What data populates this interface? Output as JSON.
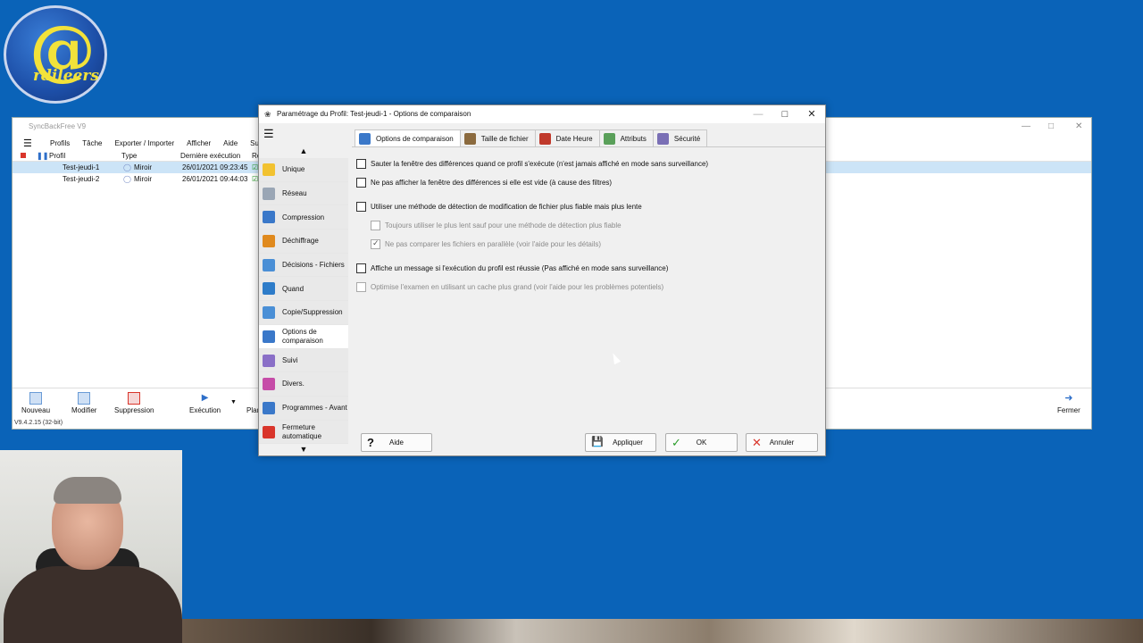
{
  "colors": {
    "desktop": "#0a63b8",
    "selection": "#cce4f7",
    "ok_green": "#2a9d2a",
    "cancel_red": "#d9352b"
  },
  "logo": {
    "text": "rdileers"
  },
  "syncback": {
    "title": "SyncBackFree V9",
    "menu": [
      "Profils",
      "Tâche",
      "Exporter / Importer",
      "Afficher",
      "Aide",
      "Sup"
    ],
    "columns": {
      "profile": "Profil",
      "type": "Type",
      "last_run": "Dernière exécution",
      "r": "Ré"
    },
    "rows": [
      {
        "name": "Test-jeudi-1",
        "type": "Miroir",
        "date": "26/01/2021 09:23:45"
      },
      {
        "name": "Test-jeudi-2",
        "type": "Miroir",
        "date": "26/01/2021 09:44:03"
      }
    ],
    "toolbar": {
      "new": "Nouveau",
      "edit": "Modifier",
      "delete": "Suppression",
      "run": "Exécution",
      "plan": "Plan",
      "close": "Fermer"
    },
    "status": "V9.4.2.15 (32-bit)"
  },
  "dialog": {
    "title": "Paramétrage du Profil: Test-jeudi-1 - Options de comparaison",
    "sidebar": [
      {
        "label": "Unique",
        "icon": "folder-icon",
        "color": "#f2c230"
      },
      {
        "label": "Réseau",
        "icon": "network-icon",
        "color": "#9aa6b5"
      },
      {
        "label": "Compression",
        "icon": "compression-icon",
        "color": "#3a78c9"
      },
      {
        "label": "Déchiffrage",
        "icon": "lock-icon",
        "color": "#e08a1e"
      },
      {
        "label": "Décisions - Fichiers",
        "icon": "decision-icon",
        "color": "#4a8fd6"
      },
      {
        "label": "Quand",
        "icon": "clock-icon",
        "color": "#2e7cc9"
      },
      {
        "label": "Copie/Suppression",
        "icon": "copy-icon",
        "color": "#4a8fd6"
      },
      {
        "label": "Options de comparaison",
        "icon": "compare-icon",
        "color": "#3a78c9"
      },
      {
        "label": "Suivi",
        "icon": "tracking-icon",
        "color": "#8a6fc7"
      },
      {
        "label": "Divers.",
        "icon": "misc-icon",
        "color": "#c64ca8"
      },
      {
        "label": "Programmes - Avant",
        "icon": "programs-icon",
        "color": "#3a78c9"
      },
      {
        "label": "Fermeture automatique",
        "icon": "close-red-icon",
        "color": "#d9352b"
      }
    ],
    "tabs": [
      {
        "label": "Options de comparaison",
        "icon": "compare-icon",
        "color": "#3a78c9"
      },
      {
        "label": "Taille de fichier",
        "icon": "scale-icon",
        "color": "#8b6a3e"
      },
      {
        "label": "Date Heure",
        "icon": "clock-icon",
        "color": "#c0392b"
      },
      {
        "label": "Attributs",
        "icon": "attributes-icon",
        "color": "#5aa05a"
      },
      {
        "label": "Sécurité",
        "icon": "security-icon",
        "color": "#7a6fb5"
      }
    ],
    "options": [
      "Sauter la fenêtre des différences quand ce profil s'exécute (n'est jamais affiché en mode sans surveillance)",
      "Ne pas afficher la fenêtre des différences si elle est vide (à cause des filtres)",
      "Utiliser une méthode de détection de modification de fichier plus fiable mais plus lente",
      "Toujours utiliser le plus lent sauf pour une méthode de détection plus fiable",
      "Ne pas comparer les fichiers en parallèle (voir l'aide pour les détails)",
      "Affiche un message si l'exécution du profil est réussie (Pas affiché en mode sans surveillance)",
      "Optimise l'examen en utilisant un cache plus grand (voir l'aide pour les problèmes potentiels)"
    ],
    "buttons": {
      "help": "Aide",
      "apply": "Appliquer",
      "ok": "OK",
      "cancel": "Annuler"
    }
  }
}
